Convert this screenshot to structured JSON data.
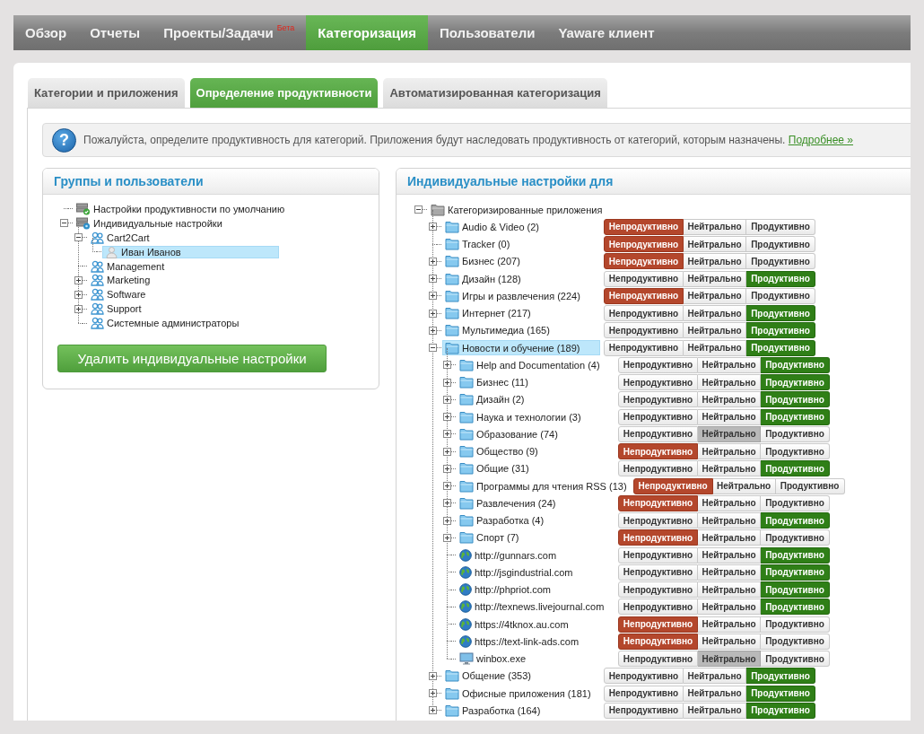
{
  "nav": [
    {
      "label": "Обзор",
      "selected": false
    },
    {
      "label": "Отчеты",
      "selected": false
    },
    {
      "label": "Проекты/Задачи",
      "badge": "Бета",
      "selected": false
    },
    {
      "label": "Категоризация",
      "selected": true
    },
    {
      "label": "Пользователи",
      "selected": false
    },
    {
      "label": "Yaware клиент",
      "selected": false
    }
  ],
  "subtabs": [
    {
      "label": "Категории и приложения",
      "selected": false
    },
    {
      "label": "Определение продуктивности",
      "selected": true
    },
    {
      "label": "Автоматизированная категоризация",
      "selected": false
    }
  ],
  "info": {
    "icon": "?",
    "text": "Пожалуйста, определите продуктивность для категорий. Приложения будут наследовать продуктивность от категорий, которым назначены.",
    "link": "Подробнее »"
  },
  "groups_panel": {
    "title": "Группы и пользователи",
    "delete_button": "Удалить индивидуальные настройки",
    "tree": [
      {
        "label": "Настройки продуктивности по умолчанию",
        "kind": "default",
        "selected": false
      },
      {
        "label": "Индивидуальные настройки",
        "kind": "custom",
        "expanded": true,
        "selected": false,
        "children": [
          {
            "label": "Cart2Cart",
            "kind": "group",
            "expanded": true,
            "selected": false,
            "children": [
              {
                "label": "Иван Иванов",
                "kind": "user",
                "selected": true
              }
            ]
          },
          {
            "label": "Management",
            "kind": "group",
            "selected": false
          },
          {
            "label": "Marketing",
            "kind": "group",
            "expanded": false,
            "selected": false
          },
          {
            "label": "Software",
            "kind": "group",
            "expanded": false,
            "selected": false
          },
          {
            "label": "Support",
            "kind": "group",
            "expanded": false,
            "selected": false
          },
          {
            "label": "Системные администраторы",
            "kind": "group",
            "selected": false
          }
        ]
      }
    ]
  },
  "settings_panel": {
    "title": "Индивидуальные настройки для",
    "tree": [
      {
        "label": "Категоризированные приложения",
        "kind": "root",
        "expanded": true,
        "selected": false,
        "children": [
          {
            "label": "Audio & Video (2)",
            "kind": "folder",
            "expanded": false,
            "selected": false,
            "options": [
              {
                "label": "Непродуктивно",
                "kind": "unproductive",
                "selected": true
              },
              {
                "label": "Нейтрально",
                "kind": "neutral",
                "selected": false
              },
              {
                "label": "Продуктивно",
                "kind": "productive",
                "selected": false
              }
            ]
          },
          {
            "label": "Tracker (0)",
            "kind": "folder",
            "selected": false,
            "options": [
              {
                "label": "Непродуктивно",
                "kind": "unproductive",
                "selected": true
              },
              {
                "label": "Нейтрально",
                "kind": "neutral",
                "selected": false
              },
              {
                "label": "Продуктивно",
                "kind": "productive",
                "selected": false
              }
            ]
          },
          {
            "label": "Бизнес (207)",
            "kind": "folder",
            "expanded": false,
            "selected": false,
            "options": [
              {
                "label": "Непродуктивно",
                "kind": "unproductive",
                "selected": true
              },
              {
                "label": "Нейтрально",
                "kind": "neutral",
                "selected": false
              },
              {
                "label": "Продуктивно",
                "kind": "productive",
                "selected": false
              }
            ]
          },
          {
            "label": "Дизайн (128)",
            "kind": "folder",
            "expanded": false,
            "selected": false,
            "options": [
              {
                "label": "Непродуктивно",
                "kind": "unproductive",
                "selected": false
              },
              {
                "label": "Нейтрально",
                "kind": "neutral",
                "selected": false
              },
              {
                "label": "Продуктивно",
                "kind": "productive",
                "selected": true
              }
            ]
          },
          {
            "label": "Игры и развлечения (224)",
            "kind": "folder",
            "expanded": false,
            "selected": false,
            "options": [
              {
                "label": "Непродуктивно",
                "kind": "unproductive",
                "selected": true
              },
              {
                "label": "Нейтрально",
                "kind": "neutral",
                "selected": false
              },
              {
                "label": "Продуктивно",
                "kind": "productive",
                "selected": false
              }
            ]
          },
          {
            "label": "Интернет (217)",
            "kind": "folder",
            "expanded": false,
            "selected": false,
            "options": [
              {
                "label": "Непродуктивно",
                "kind": "unproductive",
                "selected": false
              },
              {
                "label": "Нейтрально",
                "kind": "neutral",
                "selected": false
              },
              {
                "label": "Продуктивно",
                "kind": "productive",
                "selected": true
              }
            ]
          },
          {
            "label": "Мультимедиа (165)",
            "kind": "folder",
            "expanded": false,
            "selected": false,
            "options": [
              {
                "label": "Непродуктивно",
                "kind": "unproductive",
                "selected": false
              },
              {
                "label": "Нейтрально",
                "kind": "neutral",
                "selected": false
              },
              {
                "label": "Продуктивно",
                "kind": "productive",
                "selected": true
              }
            ]
          },
          {
            "label": "Новости и обучение (189)",
            "kind": "folder",
            "expanded": true,
            "selected": true,
            "options": [
              {
                "label": "Непродуктивно",
                "kind": "unproductive",
                "selected": false
              },
              {
                "label": "Нейтрально",
                "kind": "neutral",
                "selected": false
              },
              {
                "label": "Продуктивно",
                "kind": "productive",
                "selected": true
              }
            ],
            "children": [
              {
                "label": "Help and Documentation (4)",
                "kind": "folder",
                "expanded": false,
                "selected": false,
                "options": [
                  {
                    "label": "Непродуктивно",
                    "kind": "unproductive",
                    "selected": false
                  },
                  {
                    "label": "Нейтрально",
                    "kind": "neutral",
                    "selected": false
                  },
                  {
                    "label": "Продуктивно",
                    "kind": "productive",
                    "selected": true
                  }
                ]
              },
              {
                "label": "Бизнес (11)",
                "kind": "folder",
                "expanded": false,
                "selected": false,
                "options": [
                  {
                    "label": "Непродуктивно",
                    "kind": "unproductive",
                    "selected": false
                  },
                  {
                    "label": "Нейтрально",
                    "kind": "neutral",
                    "selected": false
                  },
                  {
                    "label": "Продуктивно",
                    "kind": "productive",
                    "selected": true
                  }
                ]
              },
              {
                "label": "Дизайн (2)",
                "kind": "folder",
                "expanded": false,
                "selected": false,
                "options": [
                  {
                    "label": "Непродуктивно",
                    "kind": "unproductive",
                    "selected": false
                  },
                  {
                    "label": "Нейтрально",
                    "kind": "neutral",
                    "selected": false
                  },
                  {
                    "label": "Продуктивно",
                    "kind": "productive",
                    "selected": true
                  }
                ]
              },
              {
                "label": "Наука и технологии (3)",
                "kind": "folder",
                "expanded": false,
                "selected": false,
                "options": [
                  {
                    "label": "Непродуктивно",
                    "kind": "unproductive",
                    "selected": false
                  },
                  {
                    "label": "Нейтрально",
                    "kind": "neutral",
                    "selected": false
                  },
                  {
                    "label": "Продуктивно",
                    "kind": "productive",
                    "selected": true
                  }
                ]
              },
              {
                "label": "Образование (74)",
                "kind": "folder",
                "expanded": false,
                "selected": false,
                "options": [
                  {
                    "label": "Непродуктивно",
                    "kind": "unproductive",
                    "selected": false
                  },
                  {
                    "label": "Нейтрально",
                    "kind": "neutral",
                    "selected": true
                  },
                  {
                    "label": "Продуктивно",
                    "kind": "productive",
                    "selected": false
                  }
                ]
              },
              {
                "label": "Общество (9)",
                "kind": "folder",
                "expanded": false,
                "selected": false,
                "options": [
                  {
                    "label": "Непродуктивно",
                    "kind": "unproductive",
                    "selected": true
                  },
                  {
                    "label": "Нейтрально",
                    "kind": "neutral",
                    "selected": false
                  },
                  {
                    "label": "Продуктивно",
                    "kind": "productive",
                    "selected": false
                  }
                ]
              },
              {
                "label": "Общие (31)",
                "kind": "folder",
                "expanded": false,
                "selected": false,
                "options": [
                  {
                    "label": "Непродуктивно",
                    "kind": "unproductive",
                    "selected": false
                  },
                  {
                    "label": "Нейтрально",
                    "kind": "neutral",
                    "selected": false
                  },
                  {
                    "label": "Продуктивно",
                    "kind": "productive",
                    "selected": true
                  }
                ]
              },
              {
                "label": "Программы для чтения RSS (13)",
                "kind": "folder",
                "expanded": false,
                "selected": false,
                "options": [
                  {
                    "label": "Непродуктивно",
                    "kind": "unproductive",
                    "selected": true
                  },
                  {
                    "label": "Нейтрально",
                    "kind": "neutral",
                    "selected": false
                  },
                  {
                    "label": "Продуктивно",
                    "kind": "productive",
                    "selected": false
                  }
                ]
              },
              {
                "label": "Развлечения (24)",
                "kind": "folder",
                "expanded": false,
                "selected": false,
                "options": [
                  {
                    "label": "Непродуктивно",
                    "kind": "unproductive",
                    "selected": true
                  },
                  {
                    "label": "Нейтрально",
                    "kind": "neutral",
                    "selected": false
                  },
                  {
                    "label": "Продуктивно",
                    "kind": "productive",
                    "selected": false
                  }
                ]
              },
              {
                "label": "Разработка (4)",
                "kind": "folder",
                "expanded": false,
                "selected": false,
                "options": [
                  {
                    "label": "Непродуктивно",
                    "kind": "unproductive",
                    "selected": false
                  },
                  {
                    "label": "Нейтрально",
                    "kind": "neutral",
                    "selected": false
                  },
                  {
                    "label": "Продуктивно",
                    "kind": "productive",
                    "selected": true
                  }
                ]
              },
              {
                "label": "Спорт (7)",
                "kind": "folder",
                "expanded": false,
                "selected": false,
                "options": [
                  {
                    "label": "Непродуктивно",
                    "kind": "unproductive",
                    "selected": true
                  },
                  {
                    "label": "Нейтрально",
                    "kind": "neutral",
                    "selected": false
                  },
                  {
                    "label": "Продуктивно",
                    "kind": "productive",
                    "selected": false
                  }
                ]
              },
              {
                "label": "http://gunnars.com",
                "kind": "site",
                "selected": false,
                "options": [
                  {
                    "label": "Непродуктивно",
                    "kind": "unproductive",
                    "selected": false
                  },
                  {
                    "label": "Нейтрально",
                    "kind": "neutral",
                    "selected": false
                  },
                  {
                    "label": "Продуктивно",
                    "kind": "productive",
                    "selected": true
                  }
                ]
              },
              {
                "label": "http://jsgindustrial.com",
                "kind": "site",
                "selected": false,
                "options": [
                  {
                    "label": "Непродуктивно",
                    "kind": "unproductive",
                    "selected": false
                  },
                  {
                    "label": "Нейтрально",
                    "kind": "neutral",
                    "selected": false
                  },
                  {
                    "label": "Продуктивно",
                    "kind": "productive",
                    "selected": true
                  }
                ]
              },
              {
                "label": "http://phpriot.com",
                "kind": "site",
                "selected": false,
                "options": [
                  {
                    "label": "Непродуктивно",
                    "kind": "unproductive",
                    "selected": false
                  },
                  {
                    "label": "Нейтрально",
                    "kind": "neutral",
                    "selected": false
                  },
                  {
                    "label": "Продуктивно",
                    "kind": "productive",
                    "selected": true
                  }
                ]
              },
              {
                "label": "http://texnews.livejournal.com",
                "kind": "site",
                "selected": false,
                "options": [
                  {
                    "label": "Непродуктивно",
                    "kind": "unproductive",
                    "selected": false
                  },
                  {
                    "label": "Нейтрально",
                    "kind": "neutral",
                    "selected": false
                  },
                  {
                    "label": "Продуктивно",
                    "kind": "productive",
                    "selected": true
                  }
                ]
              },
              {
                "label": "https://4tknox.au.com",
                "kind": "site",
                "selected": false,
                "options": [
                  {
                    "label": "Непродуктивно",
                    "kind": "unproductive",
                    "selected": true
                  },
                  {
                    "label": "Нейтрально",
                    "kind": "neutral",
                    "selected": false
                  },
                  {
                    "label": "Продуктивно",
                    "kind": "productive",
                    "selected": false
                  }
                ]
              },
              {
                "label": "https://text-link-ads.com",
                "kind": "site",
                "selected": false,
                "options": [
                  {
                    "label": "Непродуктивно",
                    "kind": "unproductive",
                    "selected": true
                  },
                  {
                    "label": "Нейтрально",
                    "kind": "neutral",
                    "selected": false
                  },
                  {
                    "label": "Продуктивно",
                    "kind": "productive",
                    "selected": false
                  }
                ]
              },
              {
                "label": "winbox.exe",
                "kind": "app",
                "selected": false,
                "options": [
                  {
                    "label": "Непродуктивно",
                    "kind": "unproductive",
                    "selected": false
                  },
                  {
                    "label": "Нейтрально",
                    "kind": "neutral",
                    "selected": true
                  },
                  {
                    "label": "Продуктивно",
                    "kind": "productive",
                    "selected": false
                  }
                ]
              }
            ]
          },
          {
            "label": "Общение (353)",
            "kind": "folder",
            "expanded": false,
            "selected": false,
            "options": [
              {
                "label": "Непродуктивно",
                "kind": "unproductive",
                "selected": false
              },
              {
                "label": "Нейтрально",
                "kind": "neutral",
                "selected": false
              },
              {
                "label": "Продуктивно",
                "kind": "productive",
                "selected": true
              }
            ]
          },
          {
            "label": "Офисные приложения (181)",
            "kind": "folder",
            "expanded": false,
            "selected": false,
            "options": [
              {
                "label": "Непродуктивно",
                "kind": "unproductive",
                "selected": false
              },
              {
                "label": "Нейтрально",
                "kind": "neutral",
                "selected": false
              },
              {
                "label": "Продуктивно",
                "kind": "productive",
                "selected": true
              }
            ]
          },
          {
            "label": "Разработка (164)",
            "kind": "folder",
            "expanded": false,
            "selected": false,
            "options": [
              {
                "label": "Непродуктивно",
                "kind": "unproductive",
                "selected": false
              },
              {
                "label": "Нейтрально",
                "kind": "neutral",
                "selected": false
              },
              {
                "label": "Продуктивно",
                "kind": "productive",
                "selected": true
              }
            ]
          }
        ]
      }
    ]
  }
}
